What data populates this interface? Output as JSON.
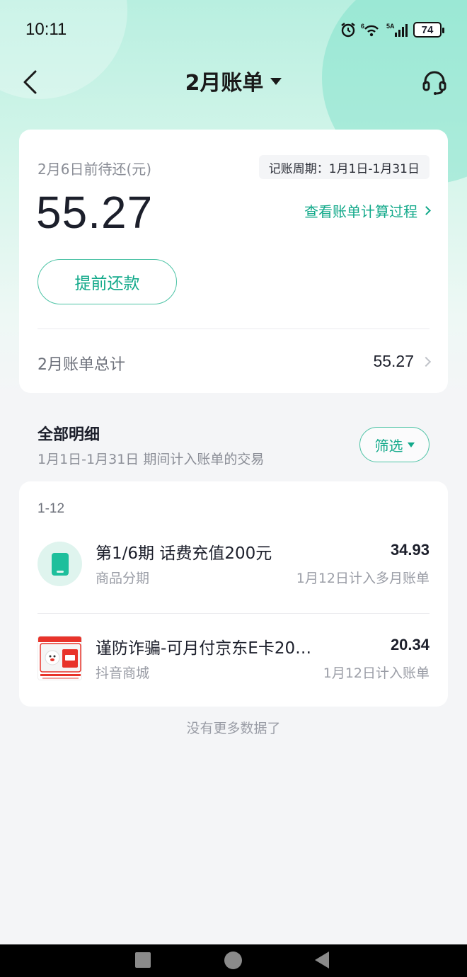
{
  "status_bar": {
    "time": "10:11",
    "battery": "74",
    "icons": [
      "alarm-icon",
      "wifi-icon",
      "signal-5g-icon",
      "battery-icon"
    ]
  },
  "header": {
    "title": "2月账单",
    "back_icon": "chevron-left-icon",
    "service_icon": "headset-icon"
  },
  "summary": {
    "due_label": "2月6日前待还(元)",
    "cycle_label": "记账周期：1月1日-1月31日",
    "amount": "55.27",
    "calc_link": "查看账单计算过程",
    "repay_button": "提前还款",
    "total_label": "2月账单总计",
    "total_value": "55.27"
  },
  "details": {
    "title": "全部明细",
    "subtitle": "1月1日-1月31日 期间计入账单的交易",
    "filter_button": "筛选"
  },
  "transactions": {
    "date_group": "1-12",
    "items": [
      {
        "title": "第1/6期 话费充值200元",
        "sub": "商品分期",
        "amount": "34.93",
        "note": "1月12日计入多月账单",
        "icon": "phone-icon"
      },
      {
        "title": "谨防诈骗-可月付京东E卡20…",
        "sub": "抖音商城",
        "amount": "20.34",
        "note": "1月12日计入账单",
        "icon": "jd-card-thumbnail"
      }
    ]
  },
  "footer": {
    "no_more": "没有更多数据了"
  },
  "colors": {
    "accent": "#12a98a",
    "accent_border": "#4cc3a5",
    "header_bg": "#b8efe0",
    "page_bg": "#f4f5f7"
  }
}
